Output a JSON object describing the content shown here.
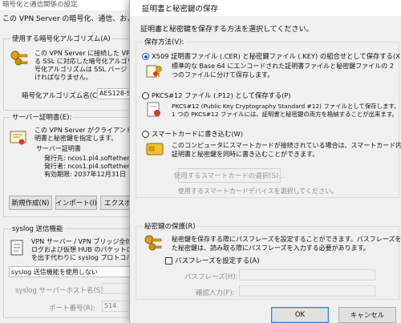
{
  "background": {
    "window_title": "暗号化と通信関係の設定",
    "title_line": "この VPN Server の暗号化、通信、およびセ",
    "algo_group": {
      "label": "使用する暗号化アルゴリズム(A)",
      "desc": [
        "この VPN Server に接続した VPN",
        "る SSL に対応した暗号化アルゴリ",
        "号化アルゴリズムは SSL バージ",
        "ければなりません。"
      ],
      "name_label": "暗号化アルゴリズム名(C):",
      "name_value": "AES128-SH"
    },
    "cert_group": {
      "label": "サーバー証明書(E):",
      "desc": [
        "この VPN Server がクライアントに",
        "明書と秘密鍵を指定します。"
      ],
      "sub_label": "サーバー証明書",
      "lines": [
        "発行先: ncos1.pi4.softether.n",
        "発行者: ncos1.pi4.softether.n",
        "有効期限: 2037年12月31日"
      ],
      "btn_new": "新規作成(N)",
      "btn_import": "インポート(I)",
      "btn_export": "エクスポー"
    },
    "syslog_group": {
      "label": "syslog 送信機能",
      "desc": [
        "VPN サーバー / VPN ブリッジ全体",
        "ログおよび仮想 HUB のパケットロ",
        "を出す代わりに syslog プロトコル"
      ],
      "select_value": "syslog 送信機能を使用しない",
      "host_label": "syslog サーバーホスト名(S):",
      "port_label": "ポート番号(R):",
      "port_value": "514"
    }
  },
  "dialog": {
    "title": "証明書と秘密鍵の保存",
    "intro": "証明書と秘密鍵を保存する方法を選択してください。",
    "method_group_label": "保存方法(V):",
    "options": [
      {
        "label": "X509 証明書ファイル (.CER) と秘密鍵ファイル (.KEY) の組合せとして保存する(X)",
        "desc": [
          "標準的な Base 64 にエンコードされた証明書ファイルと秘密鍵ファイルの 2",
          "つのファイルに分けて保存します。"
        ],
        "selected": true
      },
      {
        "label": "PKCS#12 ファイル (.P12) として保存する(P)",
        "desc": [
          "PKCS#12 (Public Key Cryptography Standard #12) ファイルとして保存します。",
          "1 つの PKCS#12 ファイルには、証明書と秘密鍵の両方を格納することが出来ます。"
        ],
        "selected": false
      },
      {
        "label": "スマートカードに書き込む(W)",
        "desc": [
          "このコンピュータにスマートカードが接続されている場合は、スマートカード内に",
          "証明書と秘密鍵を同時に書き込むことができます。"
        ],
        "selected": false
      }
    ],
    "smartcard_button": "使用するスマートカードの選択(S)...",
    "smartcard_hint": "使用するスマートカードデバイスを選択してください。",
    "protect_group": {
      "label": "秘密鍵の保護(R)",
      "desc": [
        "秘密鍵を保存する際にパスフレーズを設定することができます。パスフレーズを設定し",
        "た秘密鍵は、読み取る際にパスフレーズを入力する必要があります。"
      ],
      "checkbox_label": "パスフレーズを設定する(A)",
      "checkbox_checked": false,
      "passphrase_label": "パスフレーズ(H):",
      "confirm_label": "確認入力(F):"
    },
    "ok_label": "OK",
    "cancel_label": "キャンセル"
  },
  "colors": {
    "accent": "#1a5fc6",
    "disabled_text": "#8c8c8c"
  }
}
